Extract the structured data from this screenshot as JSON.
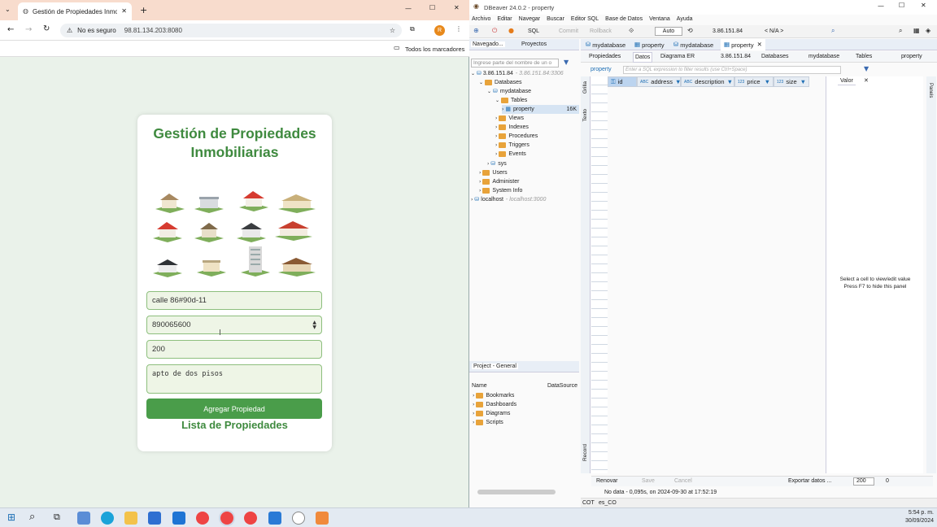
{
  "chrome": {
    "tab_title": "Gestión de Propiedades Inmob",
    "security_label": "No es seguro",
    "url": "98.81.134.203:8080",
    "profile_initial": "R",
    "bookmarks_label": "Todos los marcadores"
  },
  "app": {
    "title": "Gestión de Propiedades Inmobiliarias",
    "fields": {
      "address_value": "calle 86#90d-11",
      "id_value": "890065600",
      "price_value": "200",
      "description_value": "apto de dos pisos"
    },
    "add_button": "Agregar Propiedad",
    "list_title": "Lista de Propiedades"
  },
  "dbeaver": {
    "window_title": "DBeaver 24.0.2 - property",
    "menu": [
      "Archivo",
      "Editar",
      "Navegar",
      "Buscar",
      "Editor SQL",
      "Base de Datos",
      "Ventana",
      "Ayuda"
    ],
    "toolbar": {
      "sql": "SQL",
      "commit": "Commit",
      "rollback": "Rollback",
      "auto": "Auto",
      "connection": "3.86.151.84",
      "schema": "< N/A >"
    },
    "left_tabs": [
      "Navegado...",
      "Proyectos"
    ],
    "nav_filter_placeholder": "Ingrese parte del nombre de un o",
    "tree": {
      "connection": "3.86.151.84",
      "connection_detail": "- 3.86.151.84:3306",
      "databases": "Databases",
      "db": "mydatabase",
      "tables": "Tables",
      "table": "property",
      "table_size": "16K",
      "views": "Views",
      "indexes": "Indexes",
      "procedures": "Procedures",
      "triggers": "Triggers",
      "events": "Events",
      "sys": "sys",
      "users": "Users",
      "administer": "Administer",
      "system_info": "System Info",
      "localhost": "localhost",
      "localhost_detail": "- localhost:3000"
    },
    "editor_tabs": [
      "mydatabase",
      "property",
      "mydatabase",
      "property"
    ],
    "sub_tabs": [
      "Propiedades",
      "Datos",
      "Diagrama ER"
    ],
    "breadcrumb": [
      "3.86.151.84",
      "Databases",
      "mydatabase",
      "Tables",
      "property"
    ],
    "filter_table": "property",
    "filter_placeholder": "Enter a SQL expression to filter results (use Ctrl+Space)",
    "side_labels": [
      "Grilla",
      "Texto",
      "Record"
    ],
    "columns": [
      "id",
      "address",
      "description",
      "price",
      "size"
    ],
    "value_panel": {
      "title": "Valor",
      "hint1": "Select a cell to view/edit value",
      "hint2": "Press F7 to hide this panel"
    },
    "bottom": {
      "refresh": "Renovar",
      "save": "Save",
      "cancel": "Cancel",
      "export": "Exportar datos ...",
      "limit": "200",
      "count": "0"
    },
    "status": "No data - 0,095s, on 2024-09-30 at 17:52:19",
    "project": {
      "title": "Project - General",
      "col_name": "Name",
      "col_ds": "DataSource",
      "items": [
        "Bookmarks",
        "Dashboards",
        "Diagrams",
        "Scripts"
      ]
    },
    "statusbar": [
      "COT",
      "es_CO"
    ],
    "panels_label": "Panels"
  },
  "taskbar": {
    "time": "5:54 p. m.",
    "date": "30/09/2024"
  }
}
